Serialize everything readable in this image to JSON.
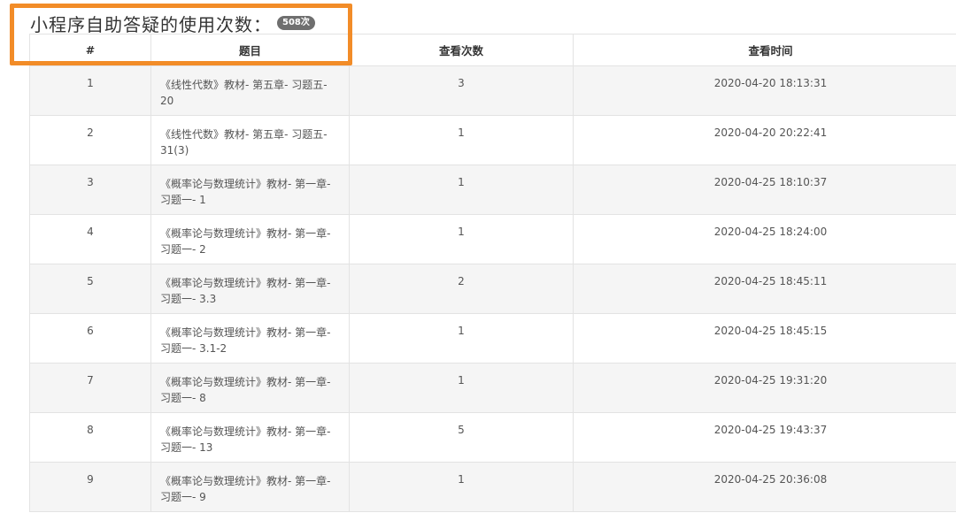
{
  "header": {
    "title": "小程序自助答疑的使用次数：",
    "count_badge": "508次"
  },
  "colors": {
    "highlight": "#f28c28",
    "badge": "#6f6f6f",
    "stripe": "#f5f5f5"
  },
  "table": {
    "columns": [
      "#",
      "题目",
      "查看次数",
      "查看时间"
    ],
    "rows": [
      {
        "num": "1",
        "subject": "《线性代数》教材- 第五章- 习题五- 20",
        "views": "3",
        "time": "2020-04-20 18:13:31"
      },
      {
        "num": "2",
        "subject": "《线性代数》教材- 第五章- 习题五- 31(3)",
        "views": "1",
        "time": "2020-04-20 20:22:41"
      },
      {
        "num": "3",
        "subject": "《概率论与数理统计》教材- 第一章- 习题一- 1",
        "views": "1",
        "time": "2020-04-25 18:10:37"
      },
      {
        "num": "4",
        "subject": "《概率论与数理统计》教材- 第一章- 习题一- 2",
        "views": "1",
        "time": "2020-04-25 18:24:00"
      },
      {
        "num": "5",
        "subject": "《概率论与数理统计》教材- 第一章- 习题一- 3.3",
        "views": "2",
        "time": "2020-04-25 18:45:11"
      },
      {
        "num": "6",
        "subject": "《概率论与数理统计》教材- 第一章- 习题一- 3.1-2",
        "views": "1",
        "time": "2020-04-25 18:45:15"
      },
      {
        "num": "7",
        "subject": "《概率论与数理统计》教材- 第一章- 习题一- 8",
        "views": "1",
        "time": "2020-04-25 19:31:20"
      },
      {
        "num": "8",
        "subject": "《概率论与数理统计》教材- 第一章- 习题一- 13",
        "views": "5",
        "time": "2020-04-25 19:43:37"
      },
      {
        "num": "9",
        "subject": "《概率论与数理统计》教材- 第一章- 习题一- 9",
        "views": "1",
        "time": "2020-04-25 20:36:08"
      }
    ]
  }
}
